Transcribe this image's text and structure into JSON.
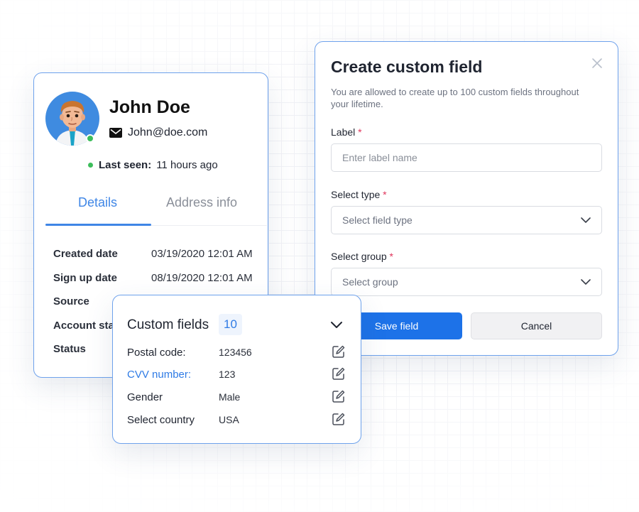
{
  "profile": {
    "name": "John Doe",
    "email": "John@doe.com",
    "last_seen_label": "Last seen:",
    "last_seen_value": "11 hours ago",
    "status_color": "#3dbd5b",
    "tabs": [
      {
        "label": "Details",
        "active": true
      },
      {
        "label": "Address info",
        "active": false
      }
    ],
    "details": [
      {
        "label": "Created date",
        "value": "03/19/2020 12:01 AM"
      },
      {
        "label": "Sign up date",
        "value": "08/19/2020 12:01 AM"
      },
      {
        "label": "Source",
        "value": ""
      },
      {
        "label": "Account status",
        "value": ""
      },
      {
        "label": "Status",
        "value": ""
      }
    ]
  },
  "dialog": {
    "title": "Create custom field",
    "close_icon": "close-icon",
    "description": "You are allowed to create up to 100 custom fields throughout your lifetime.",
    "label_field": {
      "label": "Label",
      "required_mark": "*",
      "placeholder": "Enter label name",
      "value": ""
    },
    "type_field": {
      "label": "Select type",
      "required_mark": "*",
      "placeholder": "Select field type"
    },
    "group_field": {
      "label": "Select group",
      "required_mark": "*",
      "placeholder": "Select group"
    },
    "save_label": "Save field",
    "cancel_label": "Cancel",
    "accent_color": "#1d72e8"
  },
  "custom_fields": {
    "title": "Custom fields",
    "count": "10",
    "rows": [
      {
        "label": "Postal code:",
        "value": "123456",
        "highlighted": false
      },
      {
        "label": "CVV number:",
        "value": "123",
        "highlighted": true
      },
      {
        "label": "Gender",
        "value": "Male",
        "highlighted": false
      },
      {
        "label": "Select country",
        "value": "USA",
        "highlighted": false
      }
    ]
  }
}
